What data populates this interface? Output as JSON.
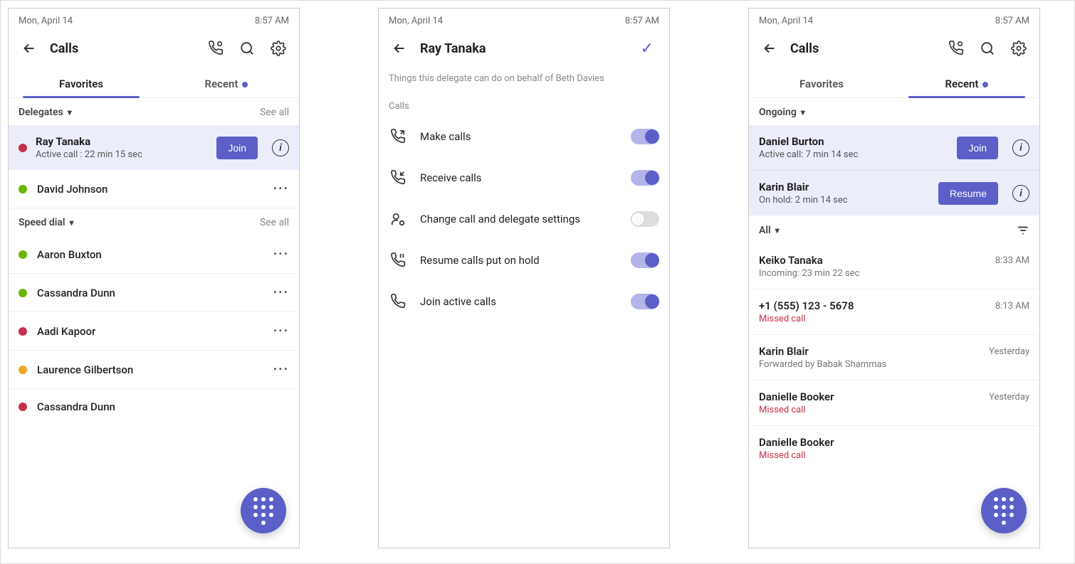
{
  "status": {
    "date": "Mon, April 14",
    "time": "8:57 AM"
  },
  "screen1": {
    "title": "Calls",
    "tabs": {
      "favorites": "Favorites",
      "recent": "Recent"
    },
    "delegates_label": "Delegates",
    "see_all": "See all",
    "active_delegate": {
      "name": "Ray Tanaka",
      "status": "Active call : 22 min 15 sec",
      "action": "Join"
    },
    "delegate_list": [
      {
        "name": "David Johnson",
        "presence": "green"
      }
    ],
    "speed_dial_label": "Speed dial",
    "speed_dial": [
      {
        "name": "Aaron Buxton",
        "presence": "green"
      },
      {
        "name": "Cassandra Dunn",
        "presence": "green"
      },
      {
        "name": "Aadi Kapoor",
        "presence": "red"
      },
      {
        "name": "Laurence Gilbertson",
        "presence": "orange"
      },
      {
        "name": "Cassandra Dunn",
        "presence": "dnd"
      }
    ]
  },
  "screen2": {
    "title": "Ray Tanaka",
    "help": "Things this delegate can do on behalf of Beth Davies",
    "section": "Calls",
    "permissions": [
      {
        "icon": "make-calls-icon",
        "label": "Make calls",
        "on": true
      },
      {
        "icon": "receive-calls-icon",
        "label": "Receive calls",
        "on": true
      },
      {
        "icon": "change-settings-icon",
        "label": "Change call and delegate settings",
        "on": false
      },
      {
        "icon": "resume-hold-icon",
        "label": "Resume calls put on hold",
        "on": true
      },
      {
        "icon": "join-active-icon",
        "label": "Join active calls",
        "on": true
      }
    ]
  },
  "screen3": {
    "title": "Calls",
    "tabs": {
      "favorites": "Favorites",
      "recent": "Recent"
    },
    "ongoing_label": "Ongoing",
    "ongoing": [
      {
        "name": "Daniel Burton",
        "sub": "Active call: 7 min 14 sec",
        "action": "Join"
      },
      {
        "name": "Karin Blair",
        "sub": "On hold: 2 min 14 sec",
        "action": "Resume"
      }
    ],
    "all_label": "All",
    "recent": [
      {
        "name": "Keiko Tanaka",
        "sub": "Incoming: 23 min 22 sec",
        "time": "8:33 AM",
        "missed": false
      },
      {
        "name": "+1 (555) 123 - 5678",
        "sub": "Missed call",
        "time": "8:13 AM",
        "missed": true
      },
      {
        "name": "Karin Blair",
        "sub": "Forwarded by Babak Shammas",
        "time": "Yesterday",
        "missed": false
      },
      {
        "name": "Danielle Booker",
        "sub": "Missed call",
        "time": "Yesterday",
        "missed": true
      },
      {
        "name": "Danielle Booker",
        "sub": "Missed call",
        "time": "",
        "missed": true
      }
    ]
  }
}
